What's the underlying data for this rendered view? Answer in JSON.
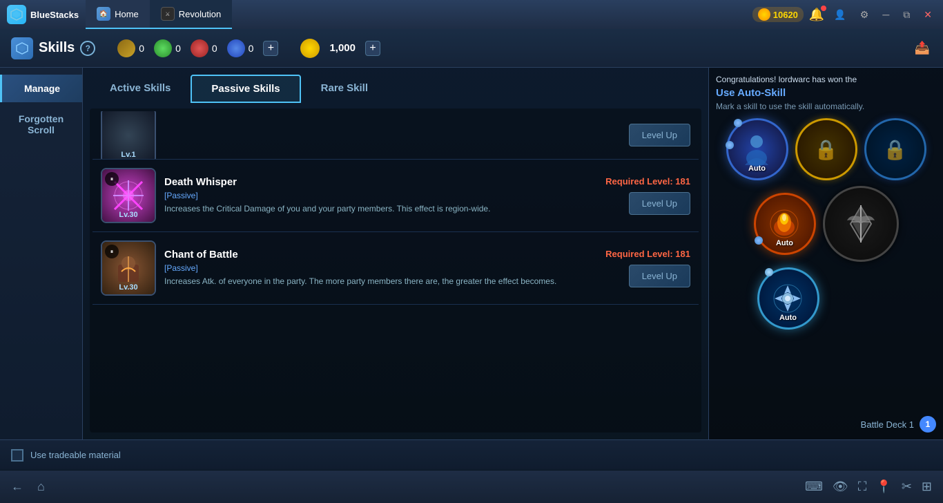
{
  "titlebar": {
    "logo_text": "B",
    "app_name": "BlueStacks",
    "tabs": [
      {
        "id": "home",
        "label": "Home",
        "active": false
      },
      {
        "id": "revolution",
        "label": "Revolution",
        "active": true
      }
    ],
    "coins": "10620",
    "window_controls": [
      "minimize",
      "restore",
      "close"
    ]
  },
  "game_topbar": {
    "back_icon": "◀",
    "title": "Skills",
    "help": "?",
    "resources": [
      {
        "id": "book",
        "icon_type": "book",
        "value": "0"
      },
      {
        "id": "gem-green",
        "icon_type": "gem-green",
        "value": "0"
      },
      {
        "id": "gem-red",
        "icon_type": "gem-red",
        "value": "0"
      },
      {
        "id": "gem-blue",
        "icon_type": "gem-blue",
        "value": "0"
      },
      {
        "id": "plus",
        "icon_type": "plus-btn",
        "value": ""
      }
    ],
    "coins": "1,000",
    "coins_plus": "+",
    "export_icon": "⬜"
  },
  "sidebar": {
    "items": [
      {
        "id": "manage",
        "label": "Manage",
        "active": true
      },
      {
        "id": "forgotten-scroll",
        "label": "Forgotten Scroll",
        "active": false
      }
    ]
  },
  "skill_tabs": {
    "tabs": [
      {
        "id": "active",
        "label": "Active Skills",
        "active": false
      },
      {
        "id": "passive",
        "label": "Passive Skills",
        "active": true
      },
      {
        "id": "rare",
        "label": "Rare Skill",
        "active": false
      }
    ]
  },
  "skills": {
    "partial_skill": {
      "level": "Lv.1",
      "level_up_btn": "Level Up"
    },
    "skill1": {
      "name": "Death Whisper",
      "type": "[Passive]",
      "description": "Increases the Critical Damage of you and your party members. This effect is region-wide.",
      "level": "Lv.30",
      "req_level": "Required Level: 181",
      "level_up_btn": "Level Up",
      "pause_icon": "⏸"
    },
    "skill2": {
      "name": "Chant of Battle",
      "type": "[Passive]",
      "description": "Increases Atk. of everyone in the party. The more party members there are, the greater the effect becomes.",
      "level": "Lv.30",
      "req_level": "Required Level: 181",
      "level_up_btn": "Level Up",
      "pause_icon": "⏸"
    }
  },
  "right_panel": {
    "congrats_text": "Congratulations! lordwarc has won the",
    "auto_skill_title": "Use Auto-Skill",
    "auto_skill_sub": "Mark a skill to use the skill automatically.",
    "slots": [
      {
        "id": "blue-char",
        "type": "blue-char",
        "label": "Auto"
      },
      {
        "id": "locked-gold",
        "type": "locked-gold",
        "label": ""
      },
      {
        "id": "locked-blue",
        "type": "locked-blue",
        "label": ""
      },
      {
        "id": "fire",
        "type": "fire",
        "label": "Auto"
      },
      {
        "id": "weapon",
        "type": "weapon",
        "label": ""
      },
      {
        "id": "ice",
        "type": "ice",
        "label": "Auto"
      }
    ],
    "battle_deck_label": "Battle Deck 1",
    "battle_deck_num": "1"
  },
  "bottom": {
    "checkbox_label": "Use tradeable material"
  },
  "bs_bottombar": {
    "left_icons": [
      "back",
      "home"
    ],
    "right_icons": [
      "keyboard",
      "eye",
      "expand",
      "map",
      "scissors",
      "grid"
    ]
  }
}
